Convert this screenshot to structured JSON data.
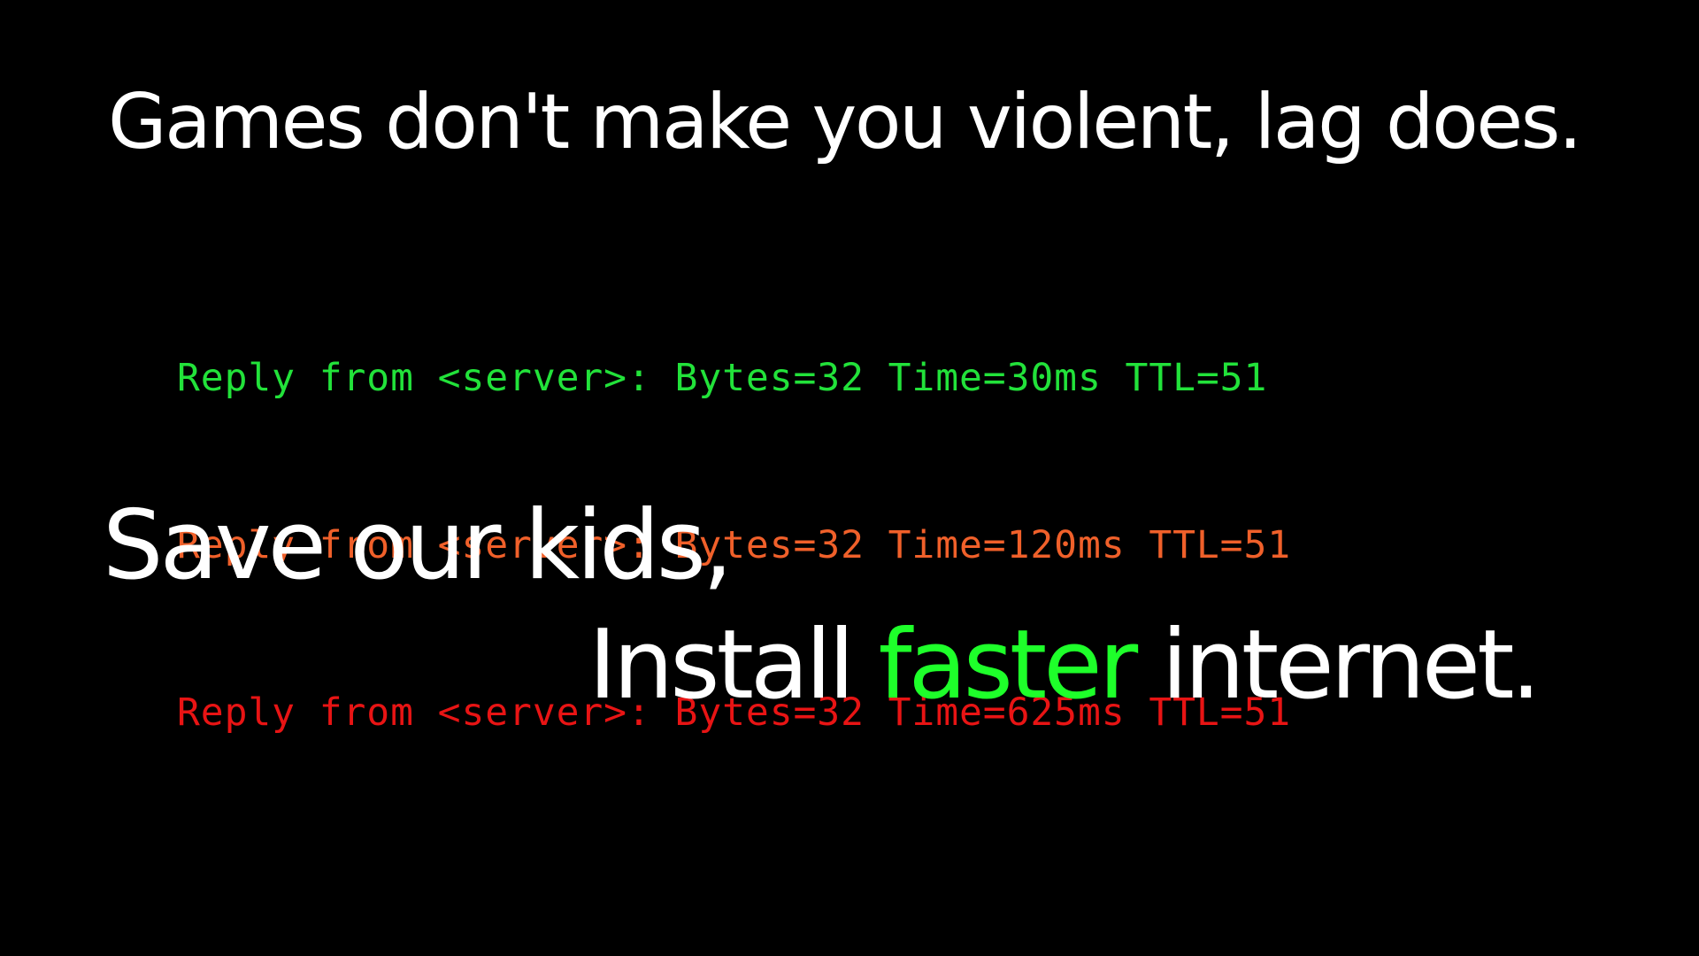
{
  "slide": {
    "headline": "Games don't make you violent, lag does.",
    "ping_lines": [
      {
        "text": "Reply from <server>: Bytes=32 Time=30ms TTL=51",
        "time_ms": 30,
        "color": "#22E23A"
      },
      {
        "text": "Reply from <server>: Bytes=32 Time=120ms TTL=51",
        "time_ms": 120,
        "color": "#F0602A"
      },
      {
        "text": "Reply from <server>: Bytes=32 Time=625ms TTL=51",
        "time_ms": 625,
        "color": "#E81414"
      }
    ],
    "tagline_line1": "Save our kids,",
    "tagline_line2": {
      "before": "Install ",
      "highlight": "faster",
      "after": " internet."
    },
    "colors": {
      "background": "#000000",
      "text": "#FFFFFF",
      "highlight": "#1EFF2A"
    }
  }
}
